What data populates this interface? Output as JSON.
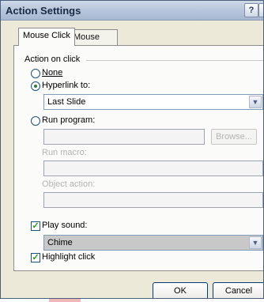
{
  "window": {
    "title": "Action Settings",
    "help_glyph": "?",
    "close_glyph": "×"
  },
  "tabs": [
    {
      "label": "Mouse Click",
      "active": true
    },
    {
      "label": "Mouse Over",
      "active": false
    }
  ],
  "action_group": {
    "label": "Action on click",
    "none_label": "None",
    "hyperlink_label": "Hyperlink to:",
    "hyperlink_value": "Last Slide",
    "run_program_label": "Run program:",
    "run_program_value": "",
    "browse_label": "Browse...",
    "run_macro_label": "Run macro:",
    "object_action_label": "Object action:",
    "selected": "hyperlink"
  },
  "sound": {
    "play_label": "Play sound:",
    "play_checked": true,
    "sound_value": "Chime"
  },
  "highlight": {
    "label": "Highlight click",
    "checked": true
  },
  "buttons": {
    "ok": "OK",
    "cancel": "Cancel"
  },
  "icons": {
    "dropdown": "chevron-down-icon",
    "check": "check-icon"
  },
  "colors": {
    "accent_stripe": "#22aee0",
    "dialog_bg": "#ece9d8"
  }
}
